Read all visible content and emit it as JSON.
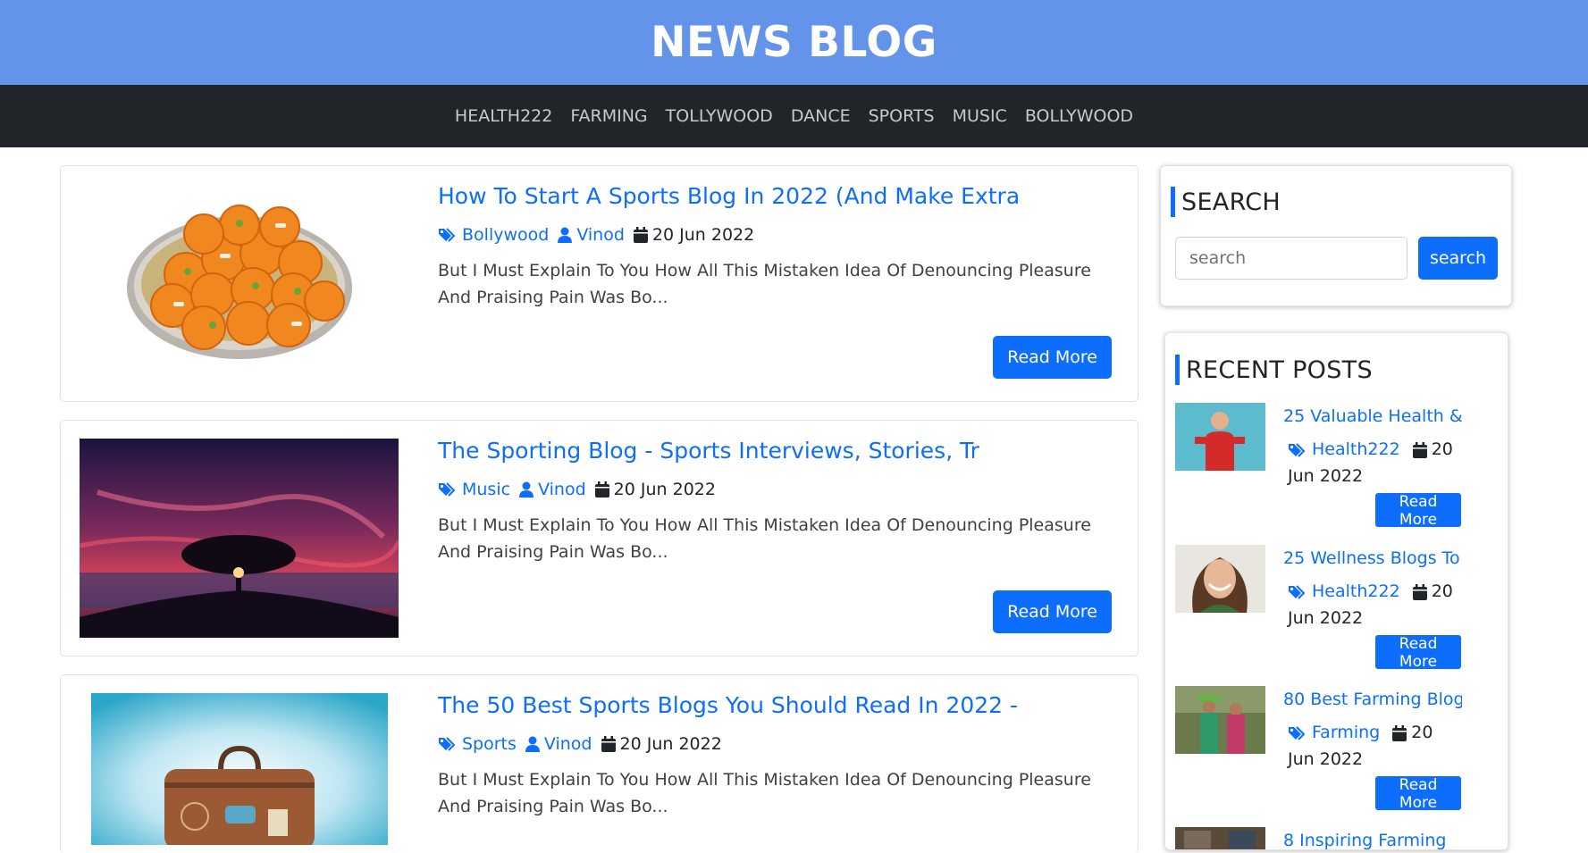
{
  "header": {
    "title": "NEWS BLOG"
  },
  "nav": {
    "items": [
      "HEALTH222",
      "FARMING",
      "TOLLYWOOD",
      "DANCE",
      "SPORTS",
      "MUSIC",
      "BOLLYWOOD"
    ]
  },
  "posts": [
    {
      "title": "How To Start A Sports Blog In 2022 (And Make Extra",
      "category": "Bollywood",
      "author": "Vinod",
      "date": "20 Jun 2022",
      "excerpt": "But I Must Explain To You How All This Mistaken Idea Of Denouncing Pleasure And Praising Pain Was Bo...",
      "button": "Read More"
    },
    {
      "title": "The Sporting Blog - Sports Interviews, Stories, Tr",
      "category": "Music",
      "author": "Vinod",
      "date": "20 Jun 2022",
      "excerpt": "But I Must Explain To You How All This Mistaken Idea Of Denouncing Pleasure And Praising Pain Was Bo...",
      "button": "Read More"
    },
    {
      "title": "The 50 Best Sports Blogs You Should Read In 2022 -",
      "category": "Sports",
      "author": "Vinod",
      "date": "20 Jun 2022",
      "excerpt": "But I Must Explain To You How All This Mistaken Idea Of Denouncing Pleasure And Praising Pain Was Bo...",
      "button": "Read More"
    }
  ],
  "search": {
    "heading": "SEARCH",
    "placeholder": "search",
    "button": "search"
  },
  "recent": {
    "heading": "RECENT POSTS",
    "items": [
      {
        "title": "25 Valuable Health &",
        "category": "Health222",
        "date": "20 Jun 2022",
        "button": "Read More"
      },
      {
        "title": "25 Wellness Blogs To",
        "category": "Health222",
        "date": "20 Jun 2022",
        "button": "Read More"
      },
      {
        "title": "80 Best Farming Blog",
        "category": "Farming",
        "date": "20 Jun 2022",
        "button": "Read More"
      },
      {
        "title": "8 Inspiring Farming"
      }
    ]
  },
  "colors": {
    "brand": "#6493ea",
    "nav_bg": "#212529",
    "primary": "#0d6efd"
  }
}
